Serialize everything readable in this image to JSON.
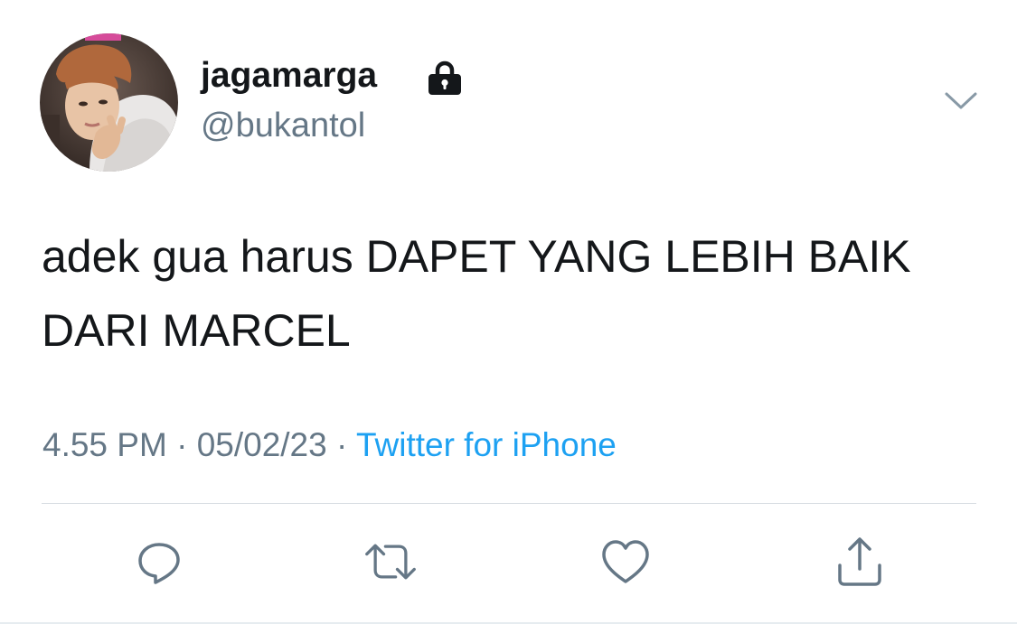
{
  "user": {
    "display_name": "jagamarga",
    "handle": "@bukantol",
    "protected_icon": "lock-icon",
    "avatar": "profile-photo"
  },
  "tweet": {
    "text": "adek gua harus DAPET YANG LEBIH BAIK DARI MARCEL"
  },
  "meta": {
    "time": "4.55 PM",
    "separator": " · ",
    "date": "05/02/23",
    "source": "Twitter for iPhone"
  },
  "menu": {
    "icon": "chevron-down-icon"
  },
  "actions": [
    {
      "icon": "reply-icon"
    },
    {
      "icon": "retweet-icon"
    },
    {
      "icon": "like-icon"
    },
    {
      "icon": "share-icon"
    }
  ],
  "colors": {
    "text": "#14171a",
    "secondary": "#657786",
    "link": "#1da1f2",
    "icon": "#657786",
    "divider": "#d8dde2"
  }
}
